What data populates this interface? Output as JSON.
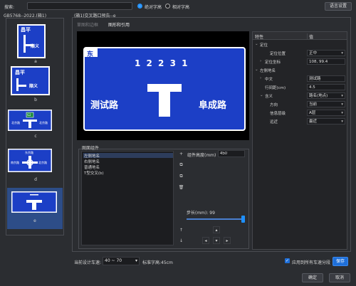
{
  "topbar": {
    "search_label": "搜索:",
    "search_value": "",
    "radio_absolute": "绝对字高",
    "radio_relative": "相对字高",
    "language_button": "语言设置"
  },
  "left": {
    "group_title": "GB5768--2022.(箱1)",
    "items": [
      {
        "label": "a",
        "text_top": "昌平",
        "text_right": "顺义"
      },
      {
        "label": "b",
        "text_top": "昌平",
        "text_right": "顺义"
      },
      {
        "label": "c",
        "route": "G2",
        "text_left": "北京路",
        "text_right": "北京路"
      },
      {
        "label": "d",
        "text_top": "东京路",
        "text_left": "南京路",
        "text_right": "北京路"
      },
      {
        "label": "e"
      }
    ]
  },
  "main": {
    "group_title": "(箱1)交叉路口预告--e",
    "tabs": [
      "草图和边框",
      "图形和引用"
    ],
    "active_tab": 1
  },
  "sign": {
    "corner_text": "东",
    "number": "1 2 2 3 1",
    "left_road": "测试路",
    "right_road": "阜成路"
  },
  "properties": {
    "header_key": "特性",
    "header_value": "值",
    "rows": [
      {
        "indent": 0,
        "arrow": "down",
        "key": "定位",
        "value": null
      },
      {
        "indent": 2,
        "arrow": "",
        "key": "定位位置",
        "value": "正中",
        "select": true
      },
      {
        "indent": 1,
        "arrow": "right",
        "key": "定位坐标",
        "value": "108, 99.4"
      },
      {
        "indent": 0,
        "arrow": "down",
        "key": "左侧地名",
        "value": null
      },
      {
        "indent": 1,
        "arrow": "right",
        "key": "中文",
        "value": "测试路"
      },
      {
        "indent": 1,
        "arrow": "",
        "key": "行间距(cm)",
        "value": "4.5"
      },
      {
        "indent": 1,
        "arrow": "down",
        "key": "含义",
        "value": "路名(地点)",
        "select": true
      },
      {
        "indent": 2,
        "arrow": "",
        "key": "方向",
        "value": "当前",
        "select": true
      },
      {
        "indent": 2,
        "arrow": "",
        "key": "信息层级",
        "value": "A层",
        "select": true
      },
      {
        "indent": 2,
        "arrow": "",
        "key": "远近",
        "value": "最近",
        "select": true
      }
    ]
  },
  "components": {
    "group_title": "图面组件",
    "items": [
      "左侧地名",
      "右侧地名",
      "普通地名",
      "T型交叉(b)"
    ],
    "selected": 0,
    "height_label": "组件高度(mm)",
    "height_value": "450",
    "step_label": "步长(mm): 99"
  },
  "bottom": {
    "speed_label": "当前设计车速:",
    "speed_value": "40 ~ 70",
    "std_label": "标准字高:45cm",
    "apply_all_label": "应用到所有车速分段",
    "save_button": "保存",
    "ok_button": "确定",
    "cancel_button": "取消"
  },
  "colors": {
    "sign_blue": "#1c3fc6",
    "accent": "#1e6fd9"
  }
}
